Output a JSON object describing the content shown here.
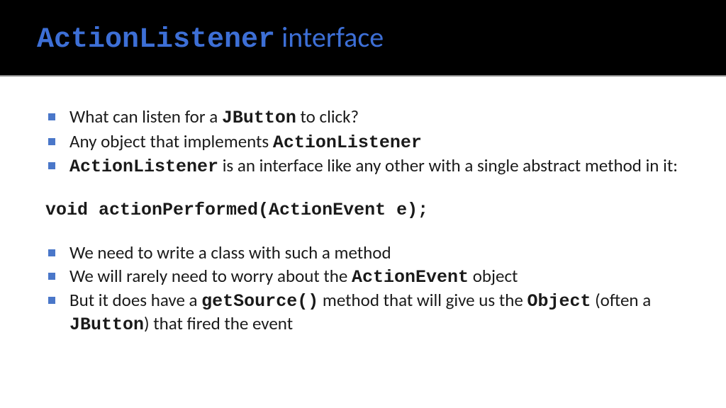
{
  "header": {
    "code": "ActionListener",
    "rest": " interface"
  },
  "b1": {
    "t1": "What can listen for a ",
    "c1": "JButton",
    "t2": " to click?"
  },
  "b2": {
    "t1": "Any object that implements ",
    "c1": "ActionListener"
  },
  "b3": {
    "c1": "ActionListener",
    "t1": " is an interface like any other with a single abstract method in it:"
  },
  "code": "void actionPerformed(ActionEvent e);",
  "b4": {
    "t1": "We need to write a class with such a method"
  },
  "b5": {
    "t1": "We will rarely need to worry about the ",
    "c1": "ActionEvent",
    "t2": " object"
  },
  "b6": {
    "t1": "But it does have a ",
    "c1": "getSource()",
    "t2": " method that will give us the ",
    "c2": "Object",
    "t3": " (often a ",
    "c3": "JButton",
    "t4": ") that fired the event"
  }
}
